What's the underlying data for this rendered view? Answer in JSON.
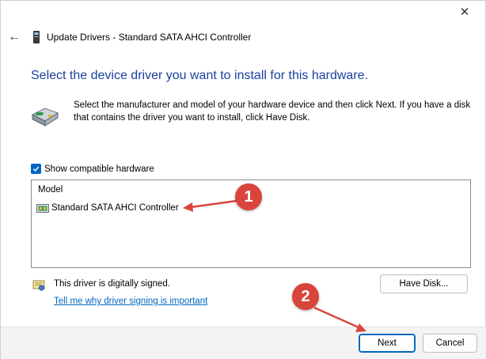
{
  "window": {
    "title": "Update Drivers - Standard SATA AHCI Controller",
    "close_glyph": "✕",
    "back_glyph": "←"
  },
  "main": {
    "heading": "Select the device driver you want to install for this hardware.",
    "intro": "Select the manufacturer and model of your hardware device and then click Next. If you have a disk that contains the driver you want to install, click Have Disk.",
    "show_compatible": {
      "label": "Show compatible hardware",
      "checked": true
    },
    "list": {
      "header": "Model",
      "items": [
        {
          "label": "Standard SATA AHCI Controller"
        }
      ]
    },
    "signed_text": "This driver is digitally signed.",
    "signing_link": "Tell me why driver signing is important",
    "have_disk_label": "Have Disk..."
  },
  "footer": {
    "next_label": "Next",
    "cancel_label": "Cancel"
  },
  "annotations": {
    "badge_1": "1",
    "badge_2": "2",
    "color": "#d9453b"
  },
  "colors": {
    "heading": "#1a3fa0",
    "accent": "#0067c0",
    "footer_bg": "#f3f3f3"
  }
}
